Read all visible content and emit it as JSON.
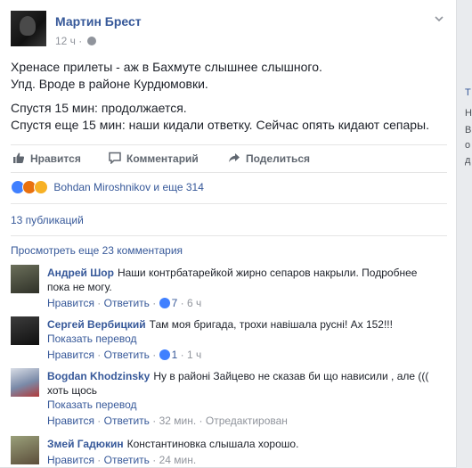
{
  "post": {
    "author": "Мартин Брест",
    "time": "12 ч",
    "dot": "·",
    "lines": [
      "Хренасе прилеты - аж в Бахмуте слышнее слышного.",
      "Упд. Вроде в районе Курдюмовки.",
      "Спустя 15 мин: продолжается.",
      "Спустя еще 15 мин: наши кидали ответку. Сейчас опять кидают сепары."
    ]
  },
  "actions": {
    "like": "Нравится",
    "comment": "Комментарий",
    "share": "Поделиться"
  },
  "reactions": {
    "names": "Bohdan Miroshnikov и еще 314"
  },
  "shares": "13 публикаций",
  "more_comments": "Просмотреть еще 23 комментария",
  "comments": [
    {
      "name": "Андрей Шор",
      "text": "Наши контрбатарейкой жирно сепаров накрыли. Подробнее пока не могу.",
      "like": "Нравится",
      "reply": "Ответить",
      "likes": "7",
      "time": "6 ч"
    },
    {
      "name": "Сергей Вербицкий",
      "text": "Там моя бригада, трохи навішала русні! Ах 152!!!",
      "translate": "Показать перевод",
      "like": "Нравится",
      "reply": "Ответить",
      "likes": "1",
      "time": "1 ч"
    },
    {
      "name": "Bogdan Khodzinsky",
      "text": "Ну в районі Зайцево не сказав би що нависили , але ((( хоть щось",
      "translate": "Показать перевод",
      "like": "Нравится",
      "reply": "Ответить",
      "time": "32 мин.",
      "edited": "Отредактирован"
    },
    {
      "name": "Змей Гадюкин",
      "text": "Константиновка слышала хорошо.",
      "like": "Нравится",
      "reply": "Ответить",
      "time": "24 мин."
    }
  ],
  "side": [
    "Т",
    "Н",
    "В",
    "о",
    "д"
  ],
  "colors": {
    "link": "#365899",
    "muted": "#90949c",
    "like_blue": "#4080ff"
  }
}
